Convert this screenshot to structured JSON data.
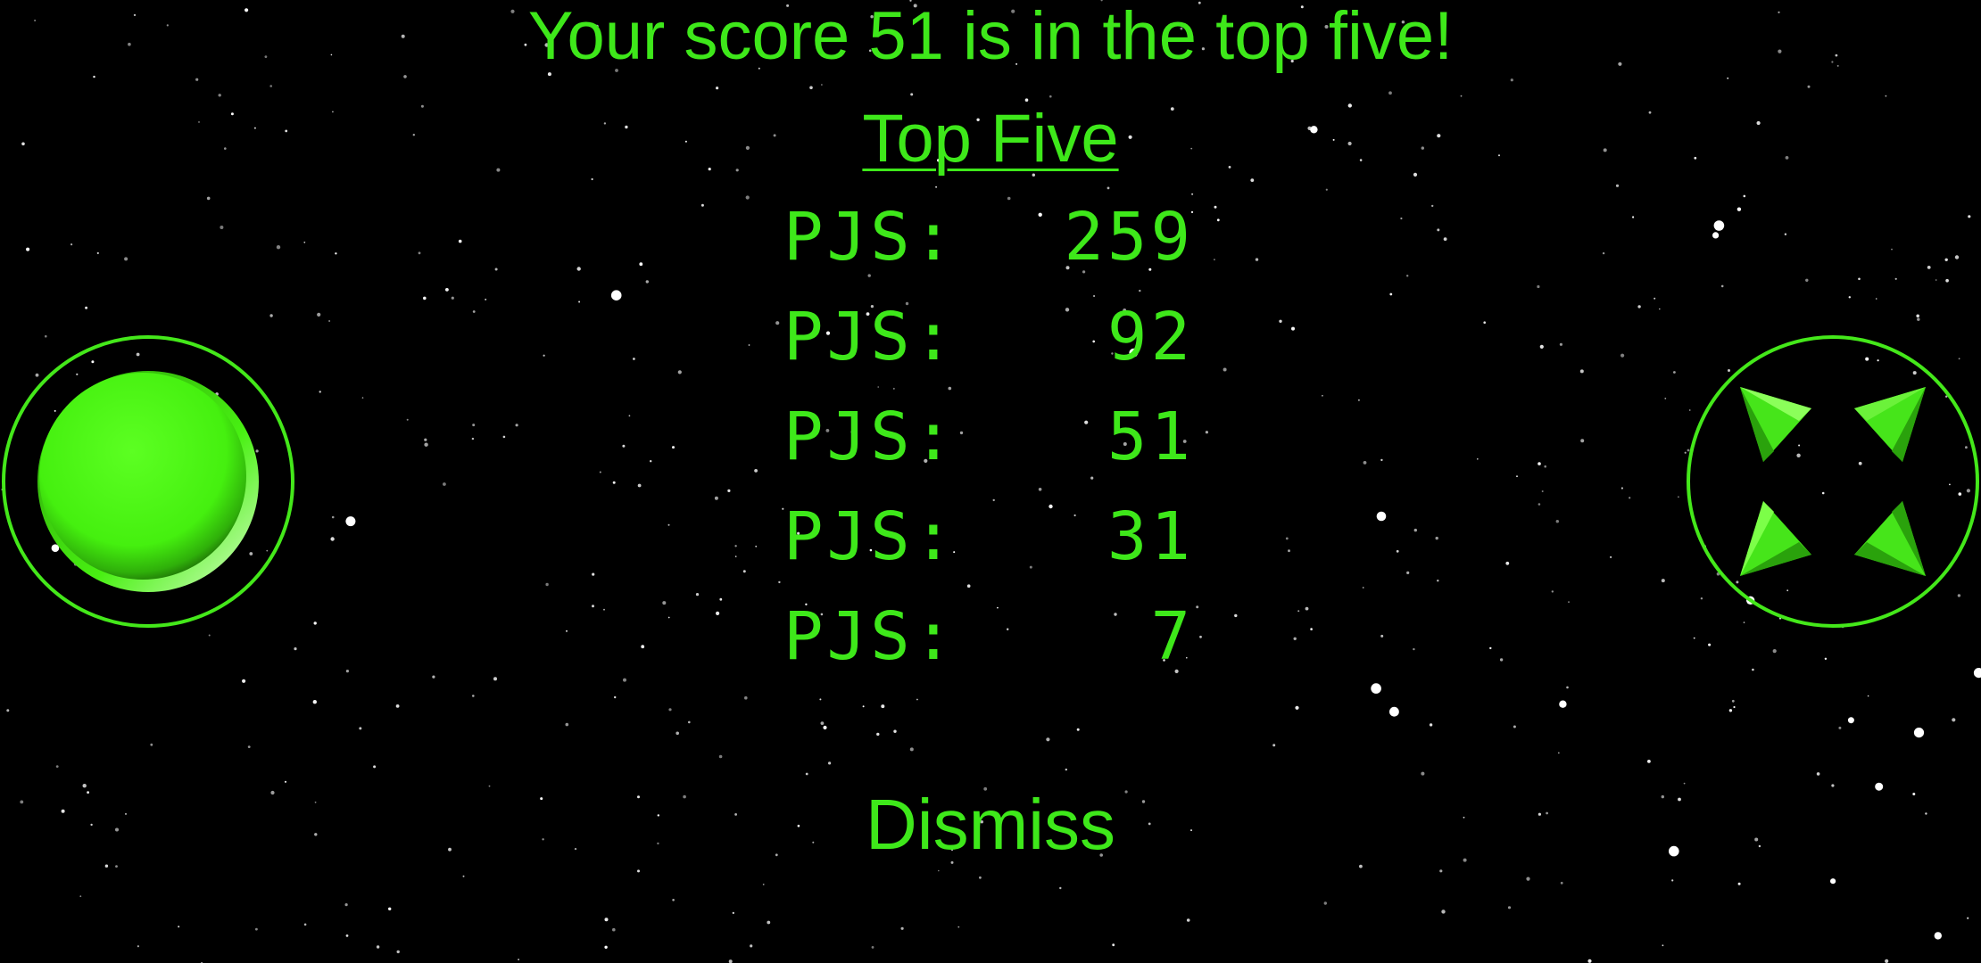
{
  "screen": {
    "headline": "Your score 51 is in the top five!",
    "board_title": "Top Five",
    "dismiss_label": "Dismiss"
  },
  "leaderboard": [
    {
      "name": "PJS:",
      "score": "259"
    },
    {
      "name": "PJS:",
      "score": "92"
    },
    {
      "name": "PJS:",
      "score": "51"
    },
    {
      "name": "PJS:",
      "score": "31"
    },
    {
      "name": "PJS:",
      "score": "7"
    }
  ],
  "controls": {
    "fire_icon": "round-fire-button-icon",
    "move_icon": "four-arrow-joystick-icon"
  },
  "colors": {
    "text": "#3ee81a",
    "background": "#000000",
    "button": "#44f10e"
  }
}
